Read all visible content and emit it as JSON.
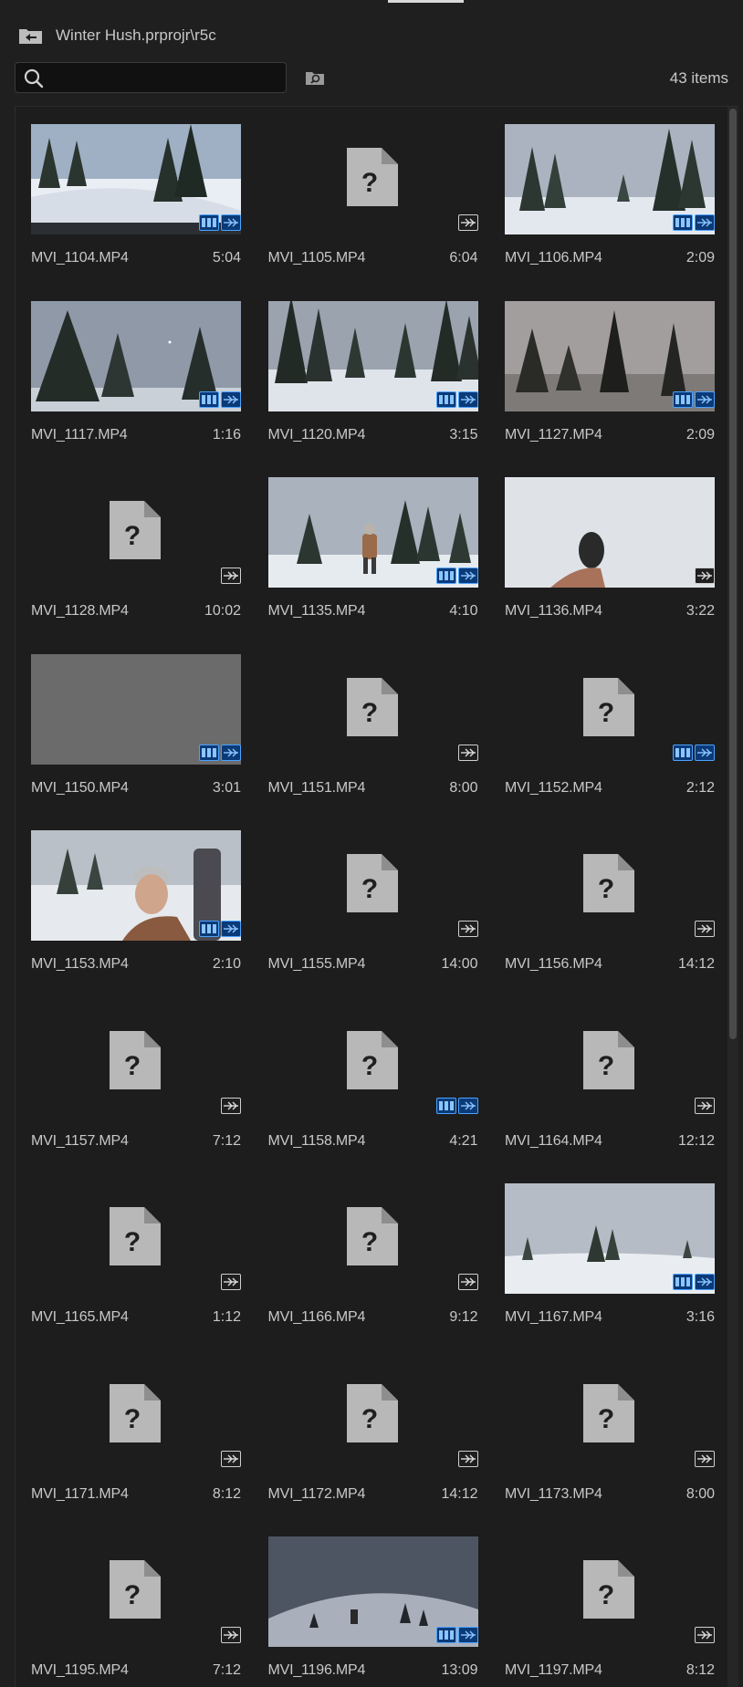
{
  "breadcrumb": {
    "path": "Winter Hush.prprojr\\r5c"
  },
  "search": {
    "placeholder": ""
  },
  "item_count": "43 items",
  "colors": {
    "accent": "#4aa3ff",
    "panel_bg": "#1d1d1d",
    "text": "#c8c8c8"
  },
  "items": [
    {
      "name": "MVI_1104.MP4",
      "duration": "5:04",
      "thumb": "scene-road",
      "video": true
    },
    {
      "name": "MVI_1105.MP4",
      "duration": "6:04",
      "thumb": "unknown",
      "video": false
    },
    {
      "name": "MVI_1106.MP4",
      "duration": "2:09",
      "thumb": "scene-forest-path",
      "video": true
    },
    {
      "name": "MVI_1117.MP4",
      "duration": "1:16",
      "thumb": "scene-trees-sky",
      "video": true
    },
    {
      "name": "MVI_1120.MP4",
      "duration": "3:15",
      "thumb": "scene-forest-track",
      "video": true
    },
    {
      "name": "MVI_1127.MP4",
      "duration": "2:09",
      "thumb": "scene-dusk-forest",
      "video": true
    },
    {
      "name": "MVI_1128.MP4",
      "duration": "10:02",
      "thumb": "unknown",
      "video": false
    },
    {
      "name": "MVI_1135.MP4",
      "duration": "4:10",
      "thumb": "scene-hiker",
      "video": true
    },
    {
      "name": "MVI_1136.MP4",
      "duration": "3:22",
      "thumb": "scene-snowshoe",
      "video": false
    },
    {
      "name": "MVI_1150.MP4",
      "duration": "3:01",
      "thumb": "scene-gray",
      "video": true
    },
    {
      "name": "MVI_1151.MP4",
      "duration": "8:00",
      "thumb": "unknown",
      "video": false
    },
    {
      "name": "MVI_1152.MP4",
      "duration": "2:12",
      "thumb": "unknown",
      "video": true
    },
    {
      "name": "MVI_1153.MP4",
      "duration": "2:10",
      "thumb": "scene-portrait",
      "video": true
    },
    {
      "name": "MVI_1155.MP4",
      "duration": "14:00",
      "thumb": "unknown",
      "video": false
    },
    {
      "name": "MVI_1156.MP4",
      "duration": "14:12",
      "thumb": "unknown",
      "video": false
    },
    {
      "name": "MVI_1157.MP4",
      "duration": "7:12",
      "thumb": "unknown",
      "video": false
    },
    {
      "name": "MVI_1158.MP4",
      "duration": "4:21",
      "thumb": "unknown",
      "video": true
    },
    {
      "name": "MVI_1164.MP4",
      "duration": "12:12",
      "thumb": "unknown",
      "video": false
    },
    {
      "name": "MVI_1165.MP4",
      "duration": "1:12",
      "thumb": "unknown",
      "video": false
    },
    {
      "name": "MVI_1166.MP4",
      "duration": "9:12",
      "thumb": "unknown",
      "video": false
    },
    {
      "name": "MVI_1167.MP4",
      "duration": "3:16",
      "thumb": "scene-snow-field",
      "video": true
    },
    {
      "name": "MVI_1171.MP4",
      "duration": "8:12",
      "thumb": "unknown",
      "video": false
    },
    {
      "name": "MVI_1172.MP4",
      "duration": "14:12",
      "thumb": "unknown",
      "video": false
    },
    {
      "name": "MVI_1173.MP4",
      "duration": "8:00",
      "thumb": "unknown",
      "video": false
    },
    {
      "name": "MVI_1195.MP4",
      "duration": "7:12",
      "thumb": "unknown",
      "video": false
    },
    {
      "name": "MVI_1196.MP4",
      "duration": "13:09",
      "thumb": "scene-hill",
      "video": true
    },
    {
      "name": "MVI_1197.MP4",
      "duration": "8:12",
      "thumb": "unknown",
      "video": false
    }
  ]
}
